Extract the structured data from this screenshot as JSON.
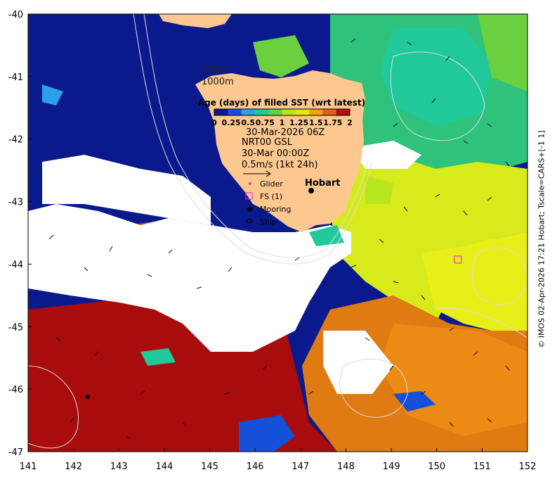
{
  "map": {
    "axes": {
      "x_ticks": [
        "141",
        "142",
        "143",
        "144",
        "145",
        "146",
        "147",
        "148",
        "149",
        "150",
        "151",
        "152"
      ],
      "y_ticks": [
        "-40",
        "-41",
        "-42",
        "-43",
        "-44",
        "-45",
        "-46",
        "-47"
      ],
      "xlim": [
        141,
        152
      ],
      "ylim": [
        -47,
        -40
      ]
    },
    "contour_labels": {
      "c200": "200m",
      "c1000": "1000m"
    },
    "colorbar": {
      "title": "Age (days) of filled SST (wrt latest)",
      "ticks": [
        "0",
        "0.25",
        "0.5",
        "0.75",
        "1",
        "1.25",
        "1.5",
        "1.75",
        "2"
      ],
      "colors": [
        "#0a1a8c",
        "#1450d8",
        "#2aa0e6",
        "#20c89a",
        "#5ad24a",
        "#b8e61e",
        "#e6e614",
        "#f2a21a",
        "#e0601a",
        "#b01010"
      ]
    },
    "sst_time": "30-Mar-2026 06Z",
    "currents": {
      "source": "NRT00 GSL",
      "time": "30-Mar 00:00Z",
      "scale": "0.5m/s (1kt 24h)"
    },
    "legend": {
      "glider": "Glider",
      "fs": "FS (1)",
      "mooring": "Mooring",
      "ship": "Ship"
    },
    "place_labels": {
      "hobart": "Hobart"
    },
    "credit": "© IMOS 02-Apr-2026 17:21 Hobart; Tscale=CARS+[-1 1]",
    "colors": {
      "land": "#fcc890",
      "no_data": "#ffffff",
      "contour": "#dcdcdc"
    }
  }
}
